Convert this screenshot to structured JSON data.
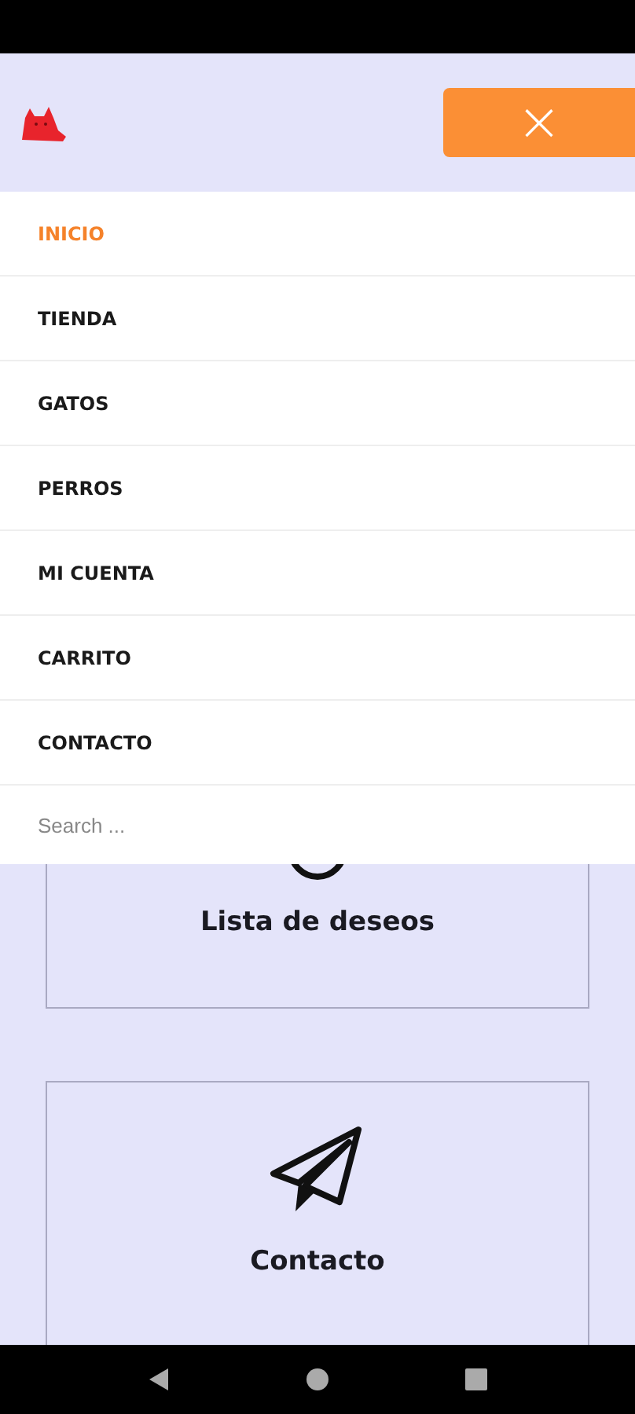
{
  "header": {
    "close_button": "×"
  },
  "menu": {
    "items": [
      {
        "label": "INICIO",
        "selected": true
      },
      {
        "label": "TIENDA",
        "selected": false
      },
      {
        "label": "GATOS",
        "selected": false
      },
      {
        "label": "PERROS",
        "selected": false
      },
      {
        "label": "MI CUENTA",
        "selected": false
      },
      {
        "label": "CARRITO",
        "selected": false
      },
      {
        "label": "CONTACTO",
        "selected": false
      }
    ],
    "search": {
      "placeholder": "Search ..."
    }
  },
  "cards": [
    {
      "label": "Lista de deseos",
      "kind": "wishlist"
    },
    {
      "label": "Contacto",
      "kind": "contact"
    }
  ]
}
